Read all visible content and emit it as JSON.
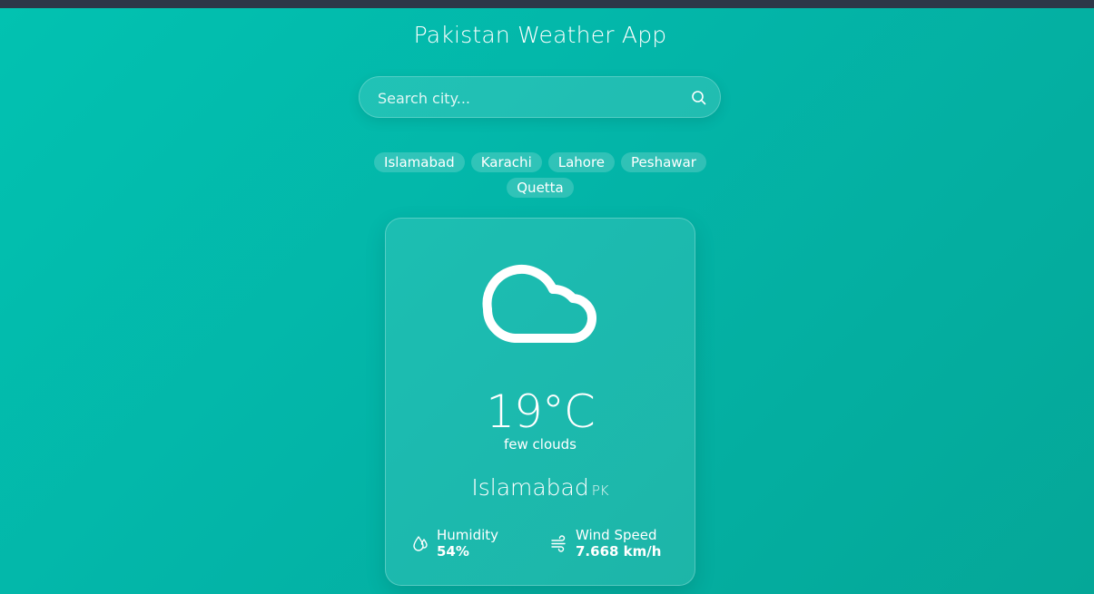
{
  "app": {
    "title": "Pakistan Weather App"
  },
  "search": {
    "placeholder": "Search city...",
    "value": "",
    "icon": "search-icon"
  },
  "cities": [
    "Islamabad",
    "Karachi",
    "Lahore",
    "Peshawar",
    "Quetta"
  ],
  "weather": {
    "icon": "cloud-icon",
    "temperature": "19°C",
    "description": "few clouds",
    "city": "Islamabad",
    "country": "PK",
    "humidity": {
      "icon": "humidity-icon",
      "label": "Humidity",
      "value": "54%"
    },
    "wind": {
      "icon": "wind-icon",
      "label": "Wind Speed",
      "value": "7.668 km/h"
    }
  },
  "colors": {
    "background_start": "#02c2b1",
    "background_end": "#05a798",
    "topbar": "#2d3748",
    "text": "#ffffff"
  }
}
